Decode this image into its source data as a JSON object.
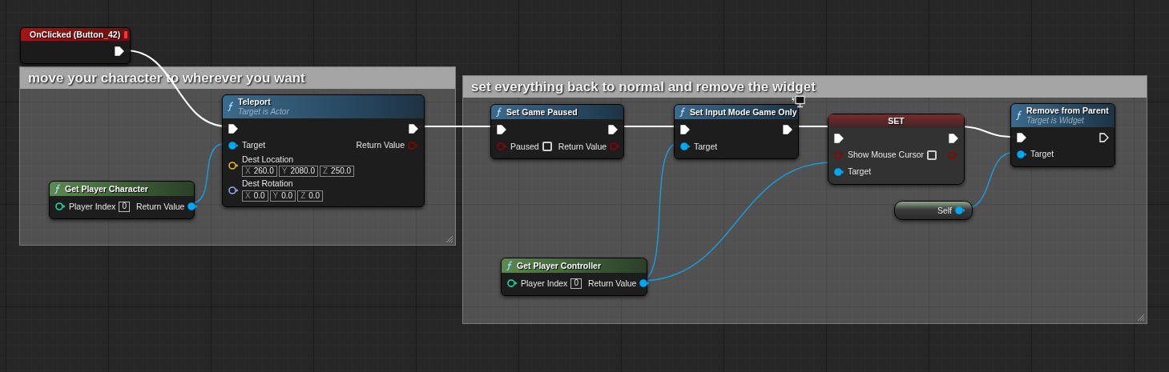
{
  "comments": [
    {
      "text": "move your character to wherever you want"
    },
    {
      "text": "set everything back to normal and remove the widget"
    }
  ],
  "nodes": [
    {
      "kind": "event",
      "title": "OnClicked (Button_42)",
      "client_only": false,
      "rows": [
        {
          "right": {
            "kind": "exec",
            "connected": true
          }
        }
      ]
    },
    {
      "kind": "function",
      "title": "Teleport",
      "subtitle": "Target is Actor",
      "client_only": false,
      "rows": [
        {
          "left": {
            "kind": "exec",
            "connected": true
          },
          "right": {
            "kind": "exec",
            "connected": true
          }
        },
        {
          "left": {
            "kind": "object",
            "label": "Target",
            "connected": true
          },
          "right": {
            "kind": "bool",
            "label": "Return Value",
            "connected": false
          }
        },
        {
          "left": {
            "kind": "vector",
            "label": "Dest Location",
            "connected": false,
            "values": [
              {
                "axis": "X",
                "value": "260.0"
              },
              {
                "axis": "Y",
                "value": "2080.0"
              },
              {
                "axis": "Z",
                "value": "250.0"
              }
            ]
          }
        },
        {
          "left": {
            "kind": "rotator",
            "label": "Dest Rotation",
            "connected": false,
            "values": [
              {
                "axis": "X",
                "value": "0.0"
              },
              {
                "axis": "Y",
                "value": "0.0"
              },
              {
                "axis": "Z",
                "value": "0.0"
              }
            ]
          }
        }
      ]
    },
    {
      "kind": "pure",
      "title": "Get Player Character",
      "client_only": false,
      "rows": [
        {
          "left": {
            "kind": "int",
            "label": "Player Index",
            "connected": false,
            "default": "0"
          },
          "right": {
            "kind": "object",
            "label": "Return Value",
            "connected": true
          }
        }
      ]
    },
    {
      "kind": "function",
      "title": "Set Game Paused",
      "client_only": false,
      "rows": [
        {
          "left": {
            "kind": "exec",
            "connected": true
          },
          "right": {
            "kind": "exec",
            "connected": true
          }
        },
        {
          "left": {
            "kind": "bool",
            "label": "Paused",
            "connected": false,
            "checked": false
          },
          "right": {
            "kind": "bool",
            "label": "Return Value",
            "connected": false
          }
        }
      ]
    },
    {
      "kind": "function",
      "title": "Set Input Mode Game Only",
      "client_only": true,
      "rows": [
        {
          "left": {
            "kind": "exec",
            "connected": true
          },
          "right": {
            "kind": "exec",
            "connected": true
          }
        },
        {
          "left": {
            "kind": "object",
            "label": "Target",
            "connected": true
          }
        }
      ]
    },
    {
      "kind": "set",
      "title": "SET",
      "client_only": false,
      "rows": [
        {
          "left": {
            "kind": "exec",
            "connected": true
          },
          "right": {
            "kind": "exec",
            "connected": true
          }
        },
        {
          "left": {
            "kind": "bool",
            "label": "Show Mouse Cursor",
            "connected": false,
            "checked": false
          },
          "right": {
            "kind": "bool",
            "connected": false
          }
        },
        {
          "left": {
            "kind": "object",
            "label": "Target",
            "connected": true
          }
        }
      ]
    },
    {
      "kind": "function",
      "title": "Remove from Parent",
      "subtitle": "Target is Widget",
      "client_only": false,
      "rows": [
        {
          "left": {
            "kind": "exec",
            "connected": true
          },
          "right": {
            "kind": "exec",
            "connected": false
          }
        },
        {
          "left": {
            "kind": "object",
            "label": "Target",
            "connected": true
          }
        }
      ]
    },
    {
      "kind": "self",
      "client_only": false,
      "rows": [
        {
          "right": {
            "kind": "object",
            "label": "Self",
            "connected": true
          }
        }
      ]
    },
    {
      "kind": "pure",
      "title": "Get Player Controller",
      "client_only": false,
      "rows": [
        {
          "left": {
            "kind": "int",
            "label": "Player Index",
            "connected": false,
            "default": "0"
          },
          "right": {
            "kind": "object",
            "label": "Return Value",
            "connected": true
          }
        }
      ]
    }
  ]
}
